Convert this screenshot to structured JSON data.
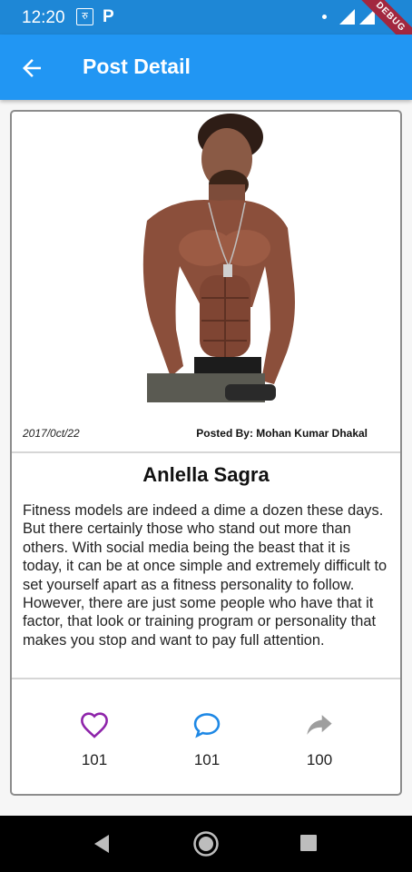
{
  "status_bar": {
    "time": "12:20",
    "rupee_icon_label": "रु",
    "p_icon_label": "P"
  },
  "debug_banner": "DEBUG",
  "app_bar": {
    "title": "Post Detail",
    "back_icon": "arrow-back-icon"
  },
  "post": {
    "date": "2017/0ct/22",
    "posted_by": "Posted By: Mohan Kumar Dhakal",
    "title": "Anlella Sagra",
    "body": "Fitness models are indeed a dime a dozen these days. But there certainly those who stand out more than others. With social media being the beast that it is today, it can be at once simple and extremely difficult to set yourself apart as a fitness personality to follow. However, there are just some people who have that it factor, that look or training program or personality that makes you stop and want to pay full attention."
  },
  "actions": {
    "likes": "101",
    "comments": "101",
    "shares": "100"
  },
  "colors": {
    "app_bar": "#2196f3",
    "status_bar": "#1e87d6",
    "like_icon": "#8e24aa",
    "comment_icon": "#1e88e5",
    "share_icon": "#9e9e9e"
  }
}
